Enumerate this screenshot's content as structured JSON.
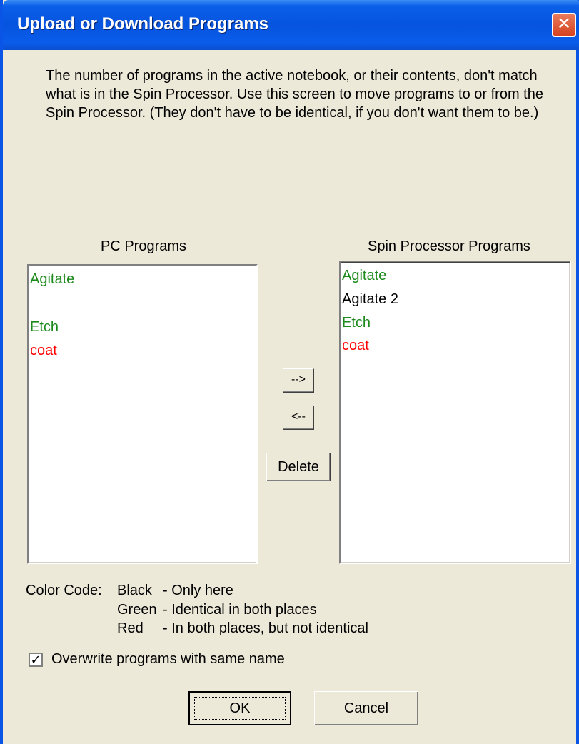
{
  "window": {
    "title": "Upload or Download Programs",
    "close_glyph": "✕"
  },
  "description": [
    "The number of programs in the active notebook, or their contents, don't match",
    "what is in the Spin Processor. Use this screen to move programs to or from the",
    "Spin Processor. (They don't have to be identical, if you don't want them to be.)"
  ],
  "pc_list": {
    "label": "PC Programs",
    "items": [
      {
        "text": "Agitate",
        "color": "#1b8a1b"
      },
      {
        "text": "",
        "color": "#000000"
      },
      {
        "text": "Etch",
        "color": "#1b8a1b"
      },
      {
        "text": "coat",
        "color": "#ff0000"
      }
    ]
  },
  "spin_list": {
    "label": "Spin Processor Programs",
    "items": [
      {
        "text": "Agitate",
        "color": "#1b8a1b"
      },
      {
        "text": "Agitate 2",
        "color": "#000000"
      },
      {
        "text": "Etch",
        "color": "#1b8a1b"
      },
      {
        "text": "coat",
        "color": "#ff0000"
      }
    ]
  },
  "buttons": {
    "to_spin": "-->",
    "to_pc": "<--",
    "delete": "Delete",
    "ok": "OK",
    "cancel": "Cancel"
  },
  "legend": {
    "heading": "Color Code:",
    "rows": [
      {
        "color": "Black",
        "desc": "- Only here"
      },
      {
        "color": "Green",
        "desc": "- Identical in both places"
      },
      {
        "color": "Red",
        "desc": "- In both places, but not identical"
      }
    ]
  },
  "overwrite": {
    "label": "Overwrite programs with same name",
    "checked": true,
    "check_glyph": "✓"
  }
}
